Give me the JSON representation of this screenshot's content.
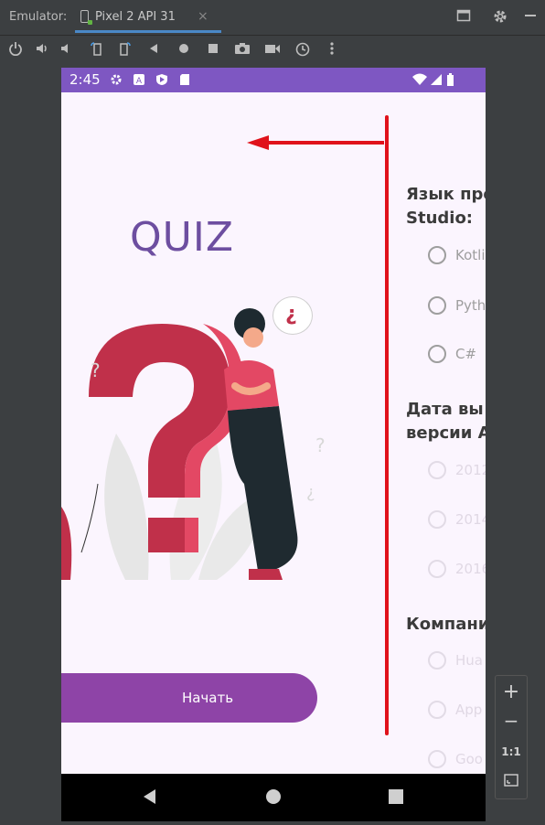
{
  "titlebar": {
    "label": "Emulator:",
    "tab_title": "Pixel 2 API 31",
    "tab_close": "×"
  },
  "toolbar_icons": [
    "power-icon",
    "volume-up-icon",
    "volume-down-icon",
    "rotate-left-icon",
    "rotate-right-icon",
    "back-icon",
    "home-icon",
    "overview-icon",
    "camera-icon",
    "video-icon",
    "snapshot-icon",
    "more-icon"
  ],
  "phone": {
    "status_time": "2:45",
    "quiz_title": "QUIZ",
    "start_button": "Начать",
    "questions": [
      {
        "heading_line1": "Язык про",
        "heading_line2": "Studio:",
        "options": [
          "Kotli",
          "Pyth",
          "C#"
        ]
      },
      {
        "heading_line1": "Дата вы",
        "heading_line2": "версии A",
        "options": [
          "2012",
          "2014",
          "2016"
        ]
      },
      {
        "heading_line1": "Компани",
        "heading_line2": "",
        "options": [
          "Hua",
          "App",
          "Goo"
        ]
      }
    ],
    "bubble_glyph": "¿",
    "colors": {
      "statusbar": "#7e57c2",
      "accent": "#8e44a7",
      "title": "#6d4ea0",
      "question": "#c0304a",
      "annotation": "#e0121b"
    }
  },
  "zoom": {
    "plus": "+",
    "minus": "−",
    "one_to_one": "1:1"
  }
}
